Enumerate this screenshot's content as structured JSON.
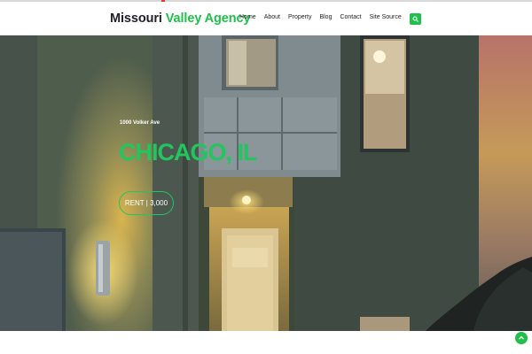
{
  "brand": {
    "part1": "Missouri",
    "part2": "Valley Agency"
  },
  "nav": {
    "items": [
      "Home",
      "About",
      "Property",
      "Blog",
      "Contact",
      "Site Source"
    ]
  },
  "search": {
    "icon": "search-icon"
  },
  "hero": {
    "address": "1000 Volker Ave",
    "city": "CHICAGO, IL",
    "price_label": "RENT | 3,000"
  },
  "back_to_top": {
    "icon": "chevron-up-icon"
  },
  "colors": {
    "accent": "#20c04a",
    "text": "#1f2126"
  }
}
